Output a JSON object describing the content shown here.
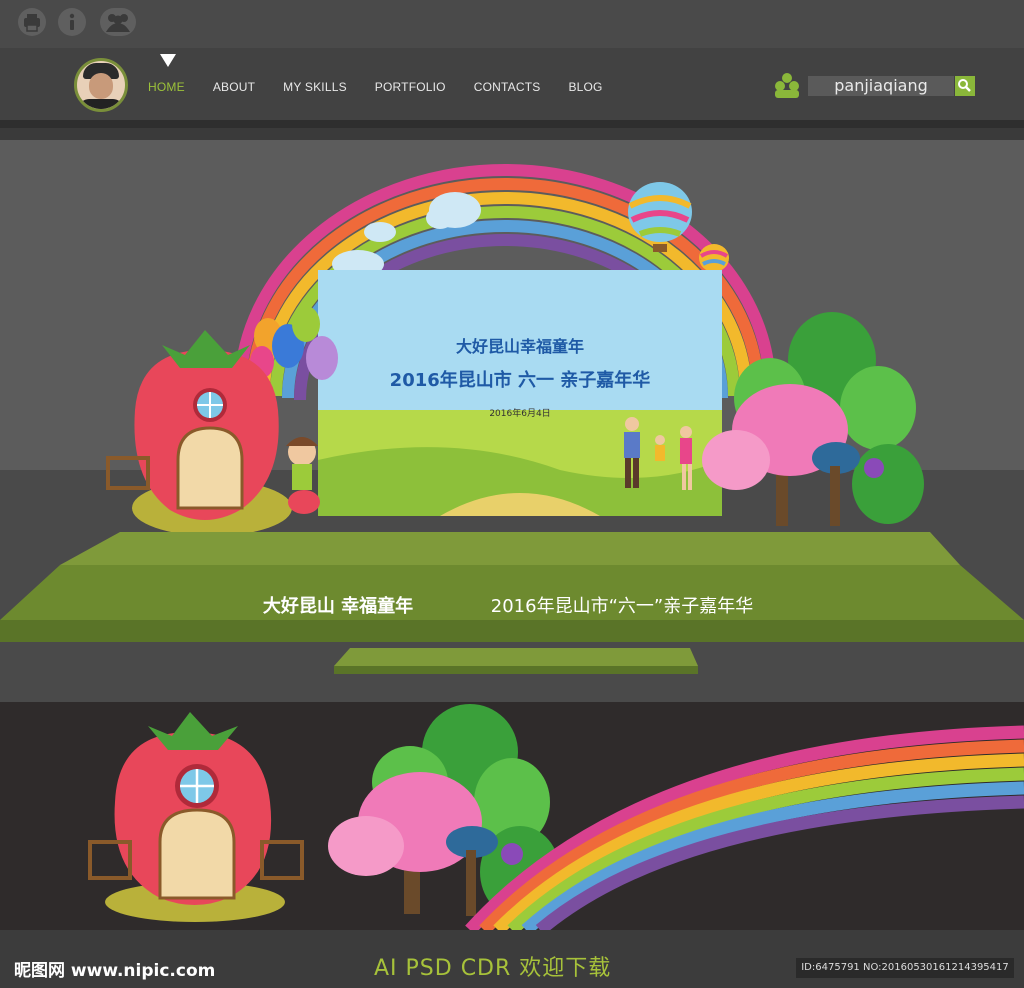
{
  "topbar": {
    "icons": [
      "printer-icon",
      "info-icon",
      "users-icon"
    ]
  },
  "nav": {
    "items": [
      {
        "label": "HOME",
        "active": true
      },
      {
        "label": "ABOUT"
      },
      {
        "label": "MY SKILLS"
      },
      {
        "label": "PORTFOLIO"
      },
      {
        "label": "CONTACTS"
      },
      {
        "label": "BLOG"
      }
    ],
    "username": "panjiaqiang"
  },
  "backdrop": {
    "title": "大好昆山幸福童年",
    "subtitle": "2016年昆山市 六一 亲子嘉年华",
    "date": "2016年6月4日"
  },
  "stage": {
    "banner_left": "大好昆山 幸福童年",
    "banner_right": "2016年昆山市“六一”亲子嘉年华"
  },
  "footer": {
    "logo": "昵图网 www.nipic.com",
    "formats": "AI  PSD  CDR  欢迎下载",
    "id_text": "ID:6475791 NO:20160530161214395417"
  },
  "colors": {
    "accent": "#9cc23a",
    "stage_green": "#6d8a2f",
    "rainbow": [
      "#d9418f",
      "#ef6a3a",
      "#f2b92c",
      "#9ccb3a",
      "#5aa0d8",
      "#7a4fa0"
    ]
  }
}
